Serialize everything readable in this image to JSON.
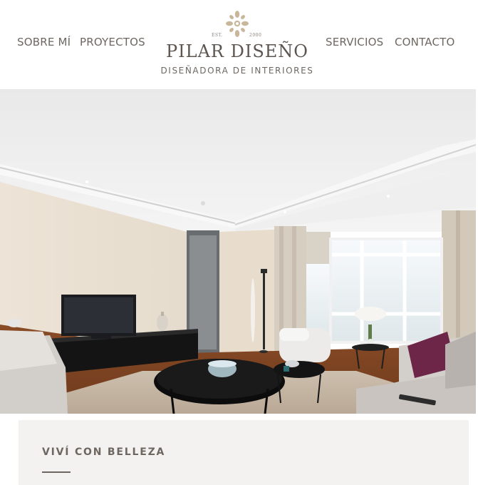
{
  "nav": {
    "left": [
      {
        "label": "SOBRE MÍ"
      },
      {
        "label": "PROYECTOS"
      }
    ],
    "right": [
      {
        "label": "SERVICIOS"
      },
      {
        "label": "CONTACTO"
      }
    ]
  },
  "logo": {
    "est_left": "EST.",
    "est_right": "2000",
    "brand": "PILAR DISEÑO",
    "tagline": "DISEÑADORA DE INTERIORES",
    "emblem_icon": "ornament-icon"
  },
  "hero": {
    "image_icon": "living-room-photo"
  },
  "card": {
    "title": "VIVÍ CON BELLEZA"
  },
  "colors": {
    "text": "#6e6761",
    "brand": "#5d5650",
    "emblem": "#c9b79c",
    "card_bg": "#f3f2f0"
  }
}
